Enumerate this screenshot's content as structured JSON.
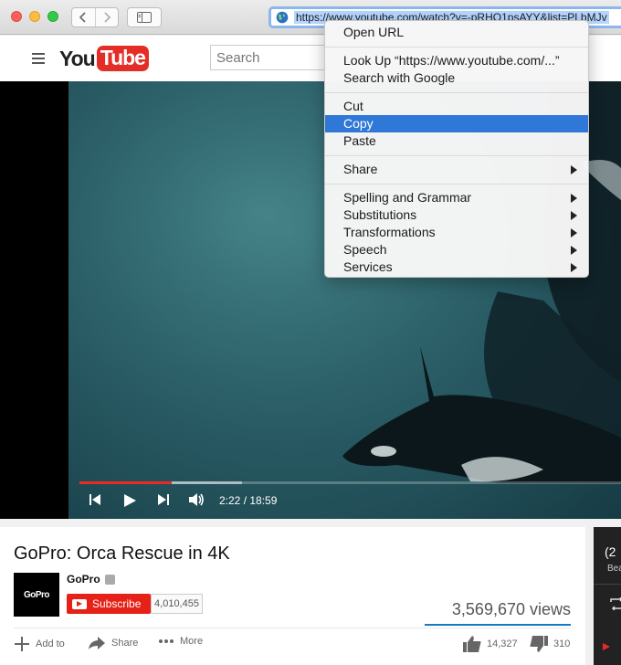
{
  "browser": {
    "url": "https://www.youtube.com/watch?v=-pRHO1psAYY&list=PLbMJv"
  },
  "youtube": {
    "logo_you": "You",
    "logo_tube": "Tube",
    "search_placeholder": "Search"
  },
  "player": {
    "time": "2:22 / 18:59",
    "progress_played": 0.17,
    "progress_buffered": 0.3
  },
  "video": {
    "title": "GoPro: Orca Rescue in 4K",
    "channel": "GoPro",
    "avatar_text": "GoPro",
    "subscribe_label": "Subscribe",
    "subscriber_count": "4,010,455",
    "views": "3,569,670 views",
    "actions": {
      "add_to": "Add to",
      "share": "Share",
      "more": "More"
    },
    "likes": "14,327",
    "dislikes": "310"
  },
  "sidebar_peek": {
    "line1": "(2",
    "line2": "Bea"
  },
  "context_menu": {
    "open_url": "Open URL",
    "look_up": "Look Up “https://www.youtube.com/...”",
    "search_google": "Search with Google",
    "cut": "Cut",
    "copy": "Copy",
    "paste": "Paste",
    "share": "Share",
    "spelling": "Spelling and Grammar",
    "substitutions": "Substitutions",
    "transformations": "Transformations",
    "speech": "Speech",
    "services": "Services"
  },
  "colors": {
    "youtube_red": "#e52d27",
    "menu_highlight": "#2f78d7",
    "subscribe_red": "#e62117"
  }
}
